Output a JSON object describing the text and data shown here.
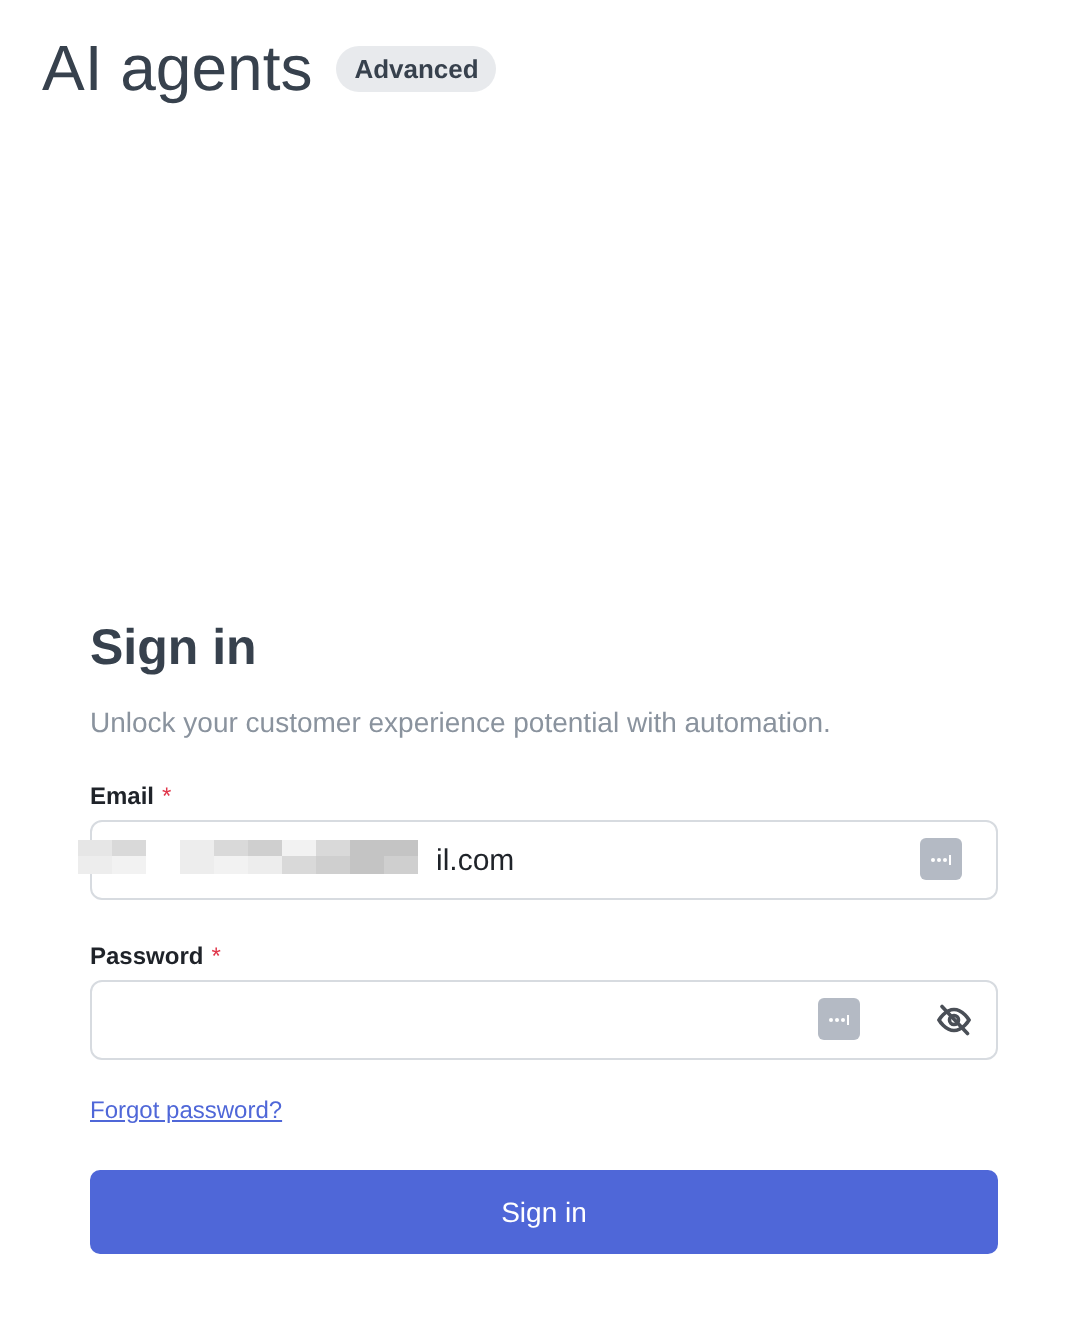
{
  "header": {
    "title": "AI agents",
    "badge": "Advanced"
  },
  "form": {
    "title": "Sign in",
    "subtitle": "Unlock your customer experience potential with automation.",
    "fields": [
      {
        "label": "Email",
        "required": true,
        "value": "il.com",
        "redacted": true,
        "reveal_toggle": false
      },
      {
        "label": "Password",
        "required": true,
        "redacted": false,
        "reveal_toggle": true
      }
    ],
    "required_mark": "*",
    "link": "Forgot password?",
    "submit": "Sign in"
  }
}
